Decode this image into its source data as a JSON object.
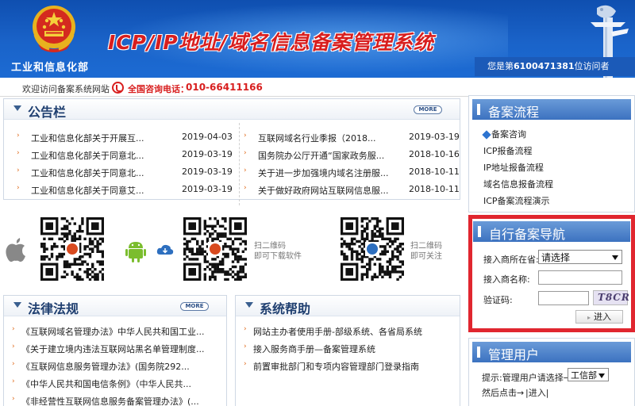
{
  "header": {
    "org_name": "工业和信息化部",
    "site_title": "ICP/IP地址/域名信息备案管理系统",
    "visitor_prefix": "您是第",
    "visitor_count": "6100471381",
    "visitor_suffix": "位访问者"
  },
  "welcome": {
    "text": "欢迎访问备案系统网站",
    "separator": "|",
    "hotline_label": "全国咨询电话：",
    "hotline_number": "010-66411166"
  },
  "announcements": {
    "title": "公告栏",
    "more_label": "MORE",
    "left": [
      {
        "title": "工业和信息化部关于开展互...",
        "date": "2019-04-03"
      },
      {
        "title": "工业和信息化部关于同意北...",
        "date": "2019-03-19"
      },
      {
        "title": "工业和信息化部关于同意北...",
        "date": "2019-03-19"
      },
      {
        "title": "工业和信息化部关于同意艾...",
        "date": "2019-03-19"
      }
    ],
    "right": [
      {
        "title": "互联网域名行业季报（2018...",
        "date": "2019-03-19"
      },
      {
        "title": "国务院办公厅开通“国家政务服...",
        "date": "2018-10-16"
      },
      {
        "title": "关于进一步加强境内域名注册服...",
        "date": "2018-10-11"
      },
      {
        "title": "关于做好政府网站互联网信息服...",
        "date": "2018-10-11"
      }
    ]
  },
  "apps": {
    "scan_line1": "扫二维码",
    "scan_line2_download": "即可下载软件",
    "scan_line2_follow": "即可关注"
  },
  "laws": {
    "title": "法律法规",
    "more_label": "MORE",
    "items": [
      "《互联网域名管理办法》中华人民共和国工业...",
      "《关于建立境内违法互联网站黑名单管理制度...",
      "《互联网信息服务管理办法》(国务院292...",
      "《中华人民共和国电信条例》（中华人民共...",
      "《非经营性互联网信息服务备案管理办法》(..."
    ]
  },
  "help": {
    "title": "系统帮助",
    "items": [
      "网站主办者使用手册-部级系统、各省局系统",
      "接入服务商手册—备案管理系统",
      "前置审批部门和专项内容管理部门登录指南"
    ]
  },
  "process": {
    "title": "备案流程",
    "items": [
      "备案咨询",
      "ICP报备流程",
      "IP地址报备流程",
      "域名信息报备流程",
      "ICP备案流程演示"
    ]
  },
  "self_nav": {
    "title": "自行备案导航",
    "province_label": "接入商所在省:",
    "province_value": "请选择",
    "name_label": "接入商名称:",
    "captcha_label": "验证码:",
    "captcha_text": "T8CR",
    "enter_label": "进入"
  },
  "admin": {
    "title": "管理用户",
    "hint": "提示:管理用户请选择→",
    "select_value": "工信部",
    "then_click": "然后点击→",
    "enter_link": "|进入|"
  },
  "colors": {
    "header_blue": "#1a63c9",
    "accent_red": "#d81e1e",
    "highlight_red": "#e0262f",
    "panel_title": "#1f3f70"
  }
}
